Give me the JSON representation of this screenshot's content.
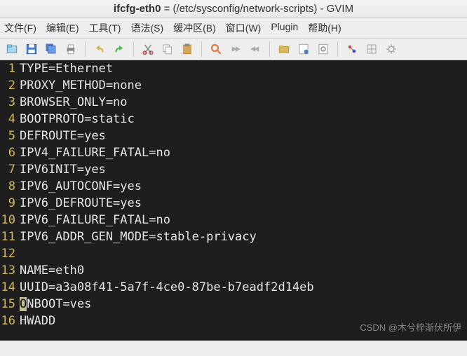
{
  "title": {
    "filename": "ifcfg-eth0",
    "path": "(/etc/sysconfig/network-scripts)",
    "app": "GVIM"
  },
  "menus": [
    "文件(F)",
    "编辑(E)",
    "工具(T)",
    "语法(S)",
    "缓冲区(B)",
    "窗口(W)",
    "Plugin",
    "帮助(H)"
  ],
  "toolbar_icons": [
    "open",
    "save",
    "save-all",
    "print",
    "",
    "undo",
    "redo",
    "",
    "cut",
    "copy",
    "paste",
    "",
    "find",
    "next",
    "prev",
    "",
    "folder",
    "script",
    "settings",
    "",
    "tag",
    "grid",
    "gear"
  ],
  "lines": [
    "TYPE=Ethernet",
    "PROXY_METHOD=none",
    "BROWSER_ONLY=no",
    "BOOTPROTO=static",
    "DEFROUTE=yes",
    "IPV4_FAILURE_FATAL=no",
    "IPV6INIT=yes",
    "IPV6_AUTOCONF=yes",
    "IPV6_DEFROUTE=yes",
    "IPV6_FAILURE_FATAL=no",
    "IPV6_ADDR_GEN_MODE=stable-privacy",
    "",
    "NAME=eth0",
    "UUID=a3a08f41-5a7f-4ce0-87be-b7eadf2d14eb",
    "ONBOOT=ves",
    "HWADD"
  ],
  "cursor": {
    "line": 15,
    "col": 0
  },
  "watermark": "CSDN @木兮梓渐伏所伊"
}
